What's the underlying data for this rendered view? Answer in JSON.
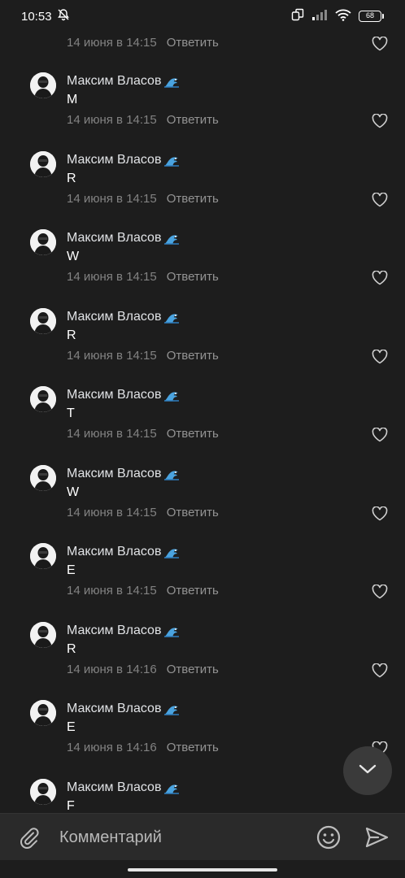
{
  "status_bar": {
    "time": "10:53",
    "battery": "68"
  },
  "partial_comment": {
    "meta_time": "14 июня в 14:15",
    "reply_label": "Ответить"
  },
  "comments": [
    {
      "author": "Максим Власов",
      "text": "M",
      "time": "14 июня в 14:15",
      "reply_label": "Ответить"
    },
    {
      "author": "Максим Власов",
      "text": "R",
      "time": "14 июня в 14:15",
      "reply_label": "Ответить"
    },
    {
      "author": "Максим Власов",
      "text": "W",
      "time": "14 июня в 14:15",
      "reply_label": "Ответить"
    },
    {
      "author": "Максим Власов",
      "text": "R",
      "time": "14 июня в 14:15",
      "reply_label": "Ответить"
    },
    {
      "author": "Максим Власов",
      "text": "T",
      "time": "14 июня в 14:15",
      "reply_label": "Ответить"
    },
    {
      "author": "Максим Власов",
      "text": "W",
      "time": "14 июня в 14:15",
      "reply_label": "Ответить"
    },
    {
      "author": "Максим Власов",
      "text": "E",
      "time": "14 июня в 14:15",
      "reply_label": "Ответить"
    },
    {
      "author": "Максим Власов",
      "text": "R",
      "time": "14 июня в 14:16",
      "reply_label": "Ответить"
    },
    {
      "author": "Максим Власов",
      "text": "E",
      "time": "14 июня в 14:16",
      "reply_label": "Ответить"
    },
    {
      "author": "Максим Власов",
      "text": "F",
      "time": "",
      "reply_label": ""
    }
  ],
  "composer": {
    "placeholder": "Комментарий"
  },
  "colors": {
    "background": "#1d1d1d",
    "composer": "#2a2a2a",
    "meta": "#828282",
    "wave_emoji": "#4aa3df"
  },
  "icons": {
    "attach": "paperclip-icon",
    "emoji": "smile-icon",
    "send": "send-icon",
    "scroll": "chevron-down-icon",
    "like": "heart-icon",
    "author_badge": "wave-emoji-icon"
  }
}
